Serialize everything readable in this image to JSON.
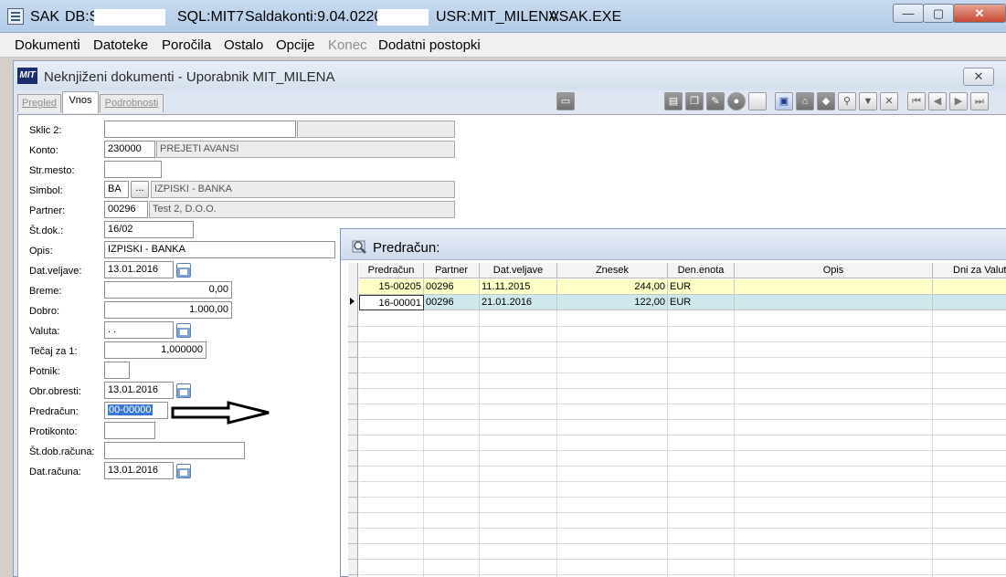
{
  "titlebar": {
    "app": "SAK",
    "db": "DB:S",
    "sql": "SQL:MIT7",
    "saldakonti": "Saldakonti:9.04.0220",
    "usr": "USR:MIT_MILENA",
    "exe": "VSAK.EXE"
  },
  "menu": [
    "Dokumenti",
    "Datoteke",
    "Poročila",
    "Ostalo",
    "Opcije",
    "Konec",
    "Dodatni postopki"
  ],
  "window": {
    "logo": "MIT",
    "title": "Neknjiženi dokumenti - Uporabnik MIT_MILENA",
    "tabs": [
      "Pregled",
      "Vnos",
      "Podrobnosti"
    ]
  },
  "form": {
    "labels": {
      "sklic2": "Sklic 2:",
      "konto": "Konto:",
      "strmesto": "Str.mesto:",
      "simbol": "Simbol:",
      "partner": "Partner:",
      "stdok": "Št.dok.:",
      "opis": "Opis:",
      "datveljave": "Dat.veljave:",
      "breme": "Breme:",
      "dobro": "Dobro:",
      "valuta": "Valuta:",
      "tecaj": "Tečaj za 1:",
      "potnik": "Potnik:",
      "obrobresti": "Obr.obresti:",
      "predracun": "Predračun:",
      "protikonto": "Protikonto:",
      "stdobracuna": "Št.dob.računa:",
      "datracuna": "Dat.računa:"
    },
    "values": {
      "konto": "230000",
      "konto_name": "PREJETI AVANSI",
      "simbol": "BA",
      "simbol_btn": "...",
      "simbol_name": "IZPISKI - BANKA",
      "partner": "00296",
      "partner_name": "Test 2, D.O.O.",
      "stdok": "16/02",
      "opis": "IZPISKI - BANKA",
      "datveljave": "13.01.2016",
      "breme": "0,00",
      "dobro": "1.000,00",
      "valuta": ". .",
      "tecaj": "1,000000",
      "obrobresti": "13.01.2016",
      "predracun": "00-00000",
      "datracuna": "13.01.2016"
    }
  },
  "popup": {
    "title": "Predračun:",
    "columns": [
      "Predračun",
      "Partner",
      "Dat.veljave",
      "Znesek",
      "Den.enota",
      "Opis",
      "Dni za Valuto"
    ],
    "rows": [
      [
        "15-00205",
        "00296",
        "11.11.2015",
        "244,00",
        "EUR",
        "",
        ""
      ],
      [
        "16-00001",
        "00296",
        "21.01.2016",
        "122,00",
        "EUR",
        "",
        ""
      ]
    ]
  },
  "colors": {
    "titlebar": "#b9cfea",
    "row_selected": "#ffffc8",
    "row_current": "#cfe8ec",
    "selection": "#3a78d8"
  }
}
